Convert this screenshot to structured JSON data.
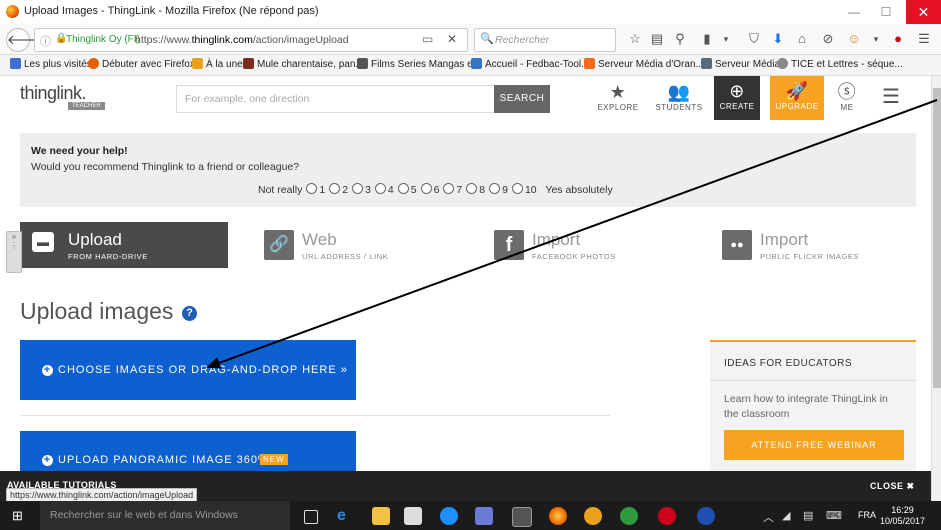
{
  "window": {
    "title": "Upload Images - ThingLink - Mozilla Firefox (Ne répond pas)",
    "minimize": "—",
    "maximize": "☐",
    "close": "✕"
  },
  "browser": {
    "org": "Thinglink Oy (FI)",
    "url_pre": "https://www.",
    "url_domain": "thinglink.com",
    "url_path": "/action/imageUpload",
    "search_placeholder": "Rechercher",
    "status_url": "https://www.thinglink.com/action/imageUpload"
  },
  "bookmarks": [
    {
      "label": "Les plus visités",
      "color": "#3b6fd4"
    },
    {
      "label": "Débuter avec Firefox",
      "color": "#e66000"
    },
    {
      "label": "À la une",
      "color": "#e8a21b"
    },
    {
      "label": "Mule charentaise, pan...",
      "color": "#7b2d1d"
    },
    {
      "label": "Films Series Mangas e...",
      "color": "#555555"
    },
    {
      "label": "Accueil - Fedbac-Tool...",
      "color": "#3874c4"
    },
    {
      "label": "Serveur Média d'Oran...",
      "color": "#f26c1c"
    },
    {
      "label": "Serveur Média",
      "color": "#5a6a7a"
    },
    {
      "label": "TICE et Lettres - séque...",
      "color": "#888888"
    }
  ],
  "header": {
    "logo": "thinglink.",
    "logo_badge": "TEACHER",
    "search_placeholder": "For example, one direction",
    "search_button": "SEARCH",
    "nav": {
      "explore": "EXPLORE",
      "students": "STUDENTS",
      "create": "CREATE",
      "upgrade": "UPGRADE",
      "me": "ME"
    }
  },
  "survey": {
    "title": "We need your help!",
    "question": "Would you recommend Thinglink to a friend or colleague?",
    "low_label": "Not really",
    "high_label": "Yes absolutely",
    "options": [
      "1",
      "2",
      "3",
      "4",
      "5",
      "6",
      "7",
      "8",
      "9",
      "10"
    ]
  },
  "tabs": {
    "upload": {
      "title": "Upload",
      "sub": "FROM HARD-DRIVE"
    },
    "web": {
      "title": "Web",
      "sub": "URL ADDRESS / LINK"
    },
    "facebook": {
      "title": "Import",
      "sub": "FACEBOOK PHOTOS"
    },
    "flickr": {
      "title": "Import",
      "sub": "PUBLIC FLICKR IMAGES"
    }
  },
  "main": {
    "heading": "Upload images",
    "choose_button": "CHOOSE IMAGES OR DRAG-AND-DROP HERE »",
    "panoramic_button": "UPLOAD PANORAMIC IMAGE 360º",
    "new_badge": "NEW"
  },
  "ideas": {
    "title": "IDEAS FOR EDUCATORS",
    "text": "Learn how to integrate ThingLink in the classroom",
    "button": "ATTEND FREE WEBINAR"
  },
  "tutorials": {
    "label": "AVAILABLE TUTORIALS",
    "close": "CLOSE"
  },
  "taskbar": {
    "search_placeholder": "Rechercher sur le web et dans Windows",
    "lang": "FRA",
    "time": "16:29",
    "date": "10/05/2017"
  },
  "colors": {
    "brand_blue": "#0e5fcf",
    "accent_orange": "#f7a320",
    "dark": "#333333"
  }
}
